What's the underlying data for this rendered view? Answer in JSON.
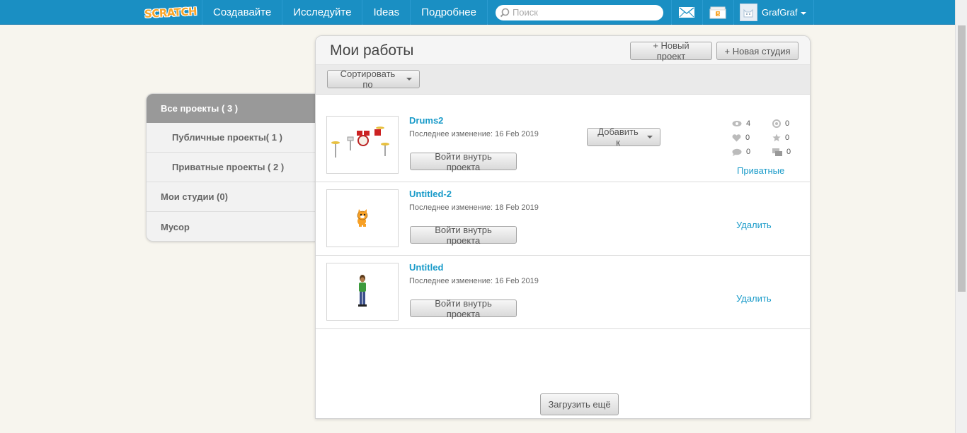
{
  "nav": {
    "logo": "SCRATCH",
    "links": [
      "Создавайте",
      "Исследуйте",
      "Ideas",
      "Подробнее"
    ],
    "search_placeholder": "Поиск",
    "username": "GrafGraf"
  },
  "main": {
    "title": "Мои работы",
    "new_project": "+ Новый проект",
    "new_studio": "+ Новая студия",
    "sort_label": "Сортировать по",
    "load_more": "Загрузить ещё"
  },
  "sidebar": {
    "items": [
      {
        "label": "Все проекты ( 3 )"
      },
      {
        "label": "Публичные проекты( 1 )"
      },
      {
        "label": "Приватные проекты ( 2 )"
      },
      {
        "label": "Мои студии (0)"
      },
      {
        "label": "Мусор"
      }
    ]
  },
  "projects": [
    {
      "title": "Drums2",
      "modified": "Последнее изменение: 16 Feb 2019",
      "enter_label": "Войти внутрь проекта",
      "add_label": "Добавить к",
      "stats": {
        "views": "4",
        "loves": "0",
        "comments": "0",
        "remixes": "0",
        "favorites": "0",
        "studios": "0"
      },
      "status_label": "Приватные"
    },
    {
      "title": "Untitled-2",
      "modified": "Последнее изменение: 18 Feb 2019",
      "enter_label": "Войти внутрь проекта",
      "delete_label": "Удалить"
    },
    {
      "title": "Untitled",
      "modified": "Последнее изменение: 16 Feb 2019",
      "enter_label": "Войти внутрь проекта",
      "delete_label": "Удалить"
    }
  ]
}
